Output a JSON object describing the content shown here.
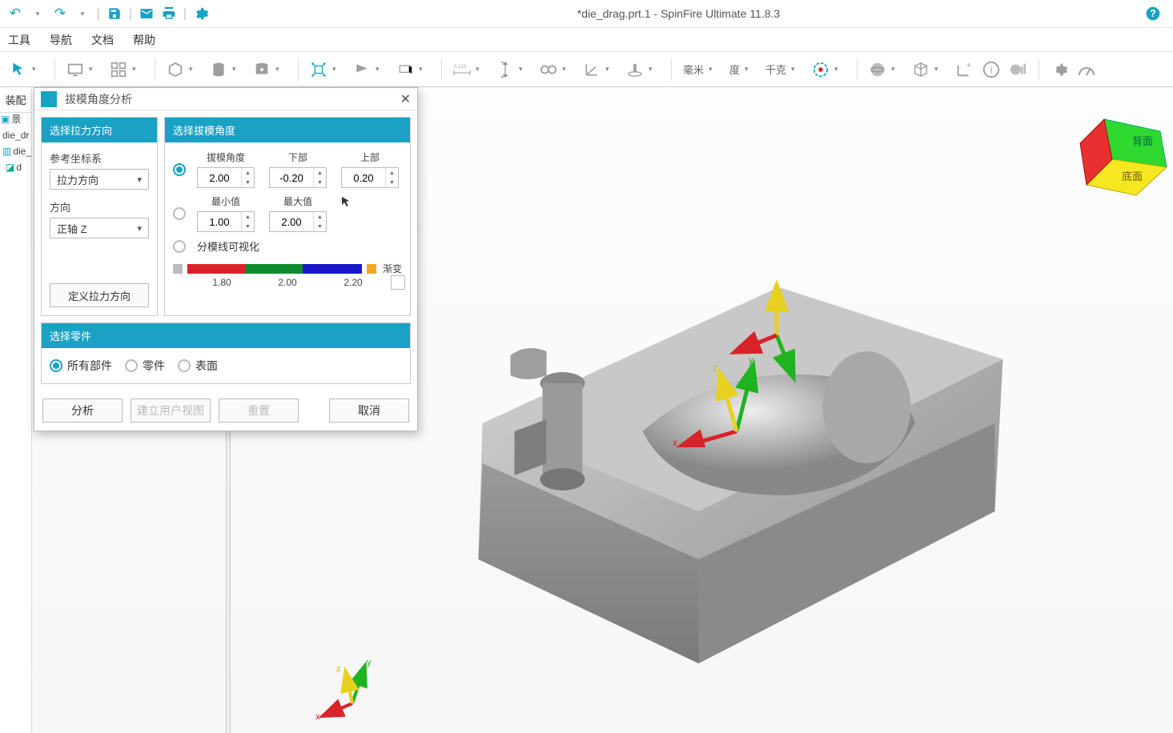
{
  "title": "*die_drag.prt.1 - SpinFire Ultimate 11.8.3",
  "menubar": [
    "工具",
    "导航",
    "文档",
    "帮助"
  ],
  "toolbar": {
    "unit_len": "毫米",
    "unit_ang": "度",
    "unit_mass": "千克"
  },
  "left_tab": "装配",
  "tree": {
    "n1": "景",
    "n2": "die_dr",
    "n3": "die_",
    "n4": "d"
  },
  "dialog": {
    "title": "拔模角度分析",
    "pull": {
      "header": "选择拉力方向",
      "ref_label": "参考坐标系",
      "ref_value": "拉力方向",
      "dir_label": "方向",
      "dir_value": "正轴 Z",
      "btn": "定义拉力方向"
    },
    "angle": {
      "header": "选择拔模角度",
      "c1": "拔模角度",
      "c2": "下部",
      "c3": "上部",
      "v1": "2.00",
      "v2": "-0.20",
      "v3": "0.20",
      "c4": "最小值",
      "c5": "最大值",
      "v4": "1.00",
      "v5": "2.00",
      "vis": "分模线可视化",
      "grad": "渐变",
      "g1": "1.80",
      "g2": "2.00",
      "g3": "2.20"
    },
    "parts": {
      "header": "选择零件",
      "o1": "所有部件",
      "o2": "零件",
      "o3": "表面"
    },
    "foot": {
      "analyze": "分析",
      "userview": "建立用户视图",
      "reset": "重置",
      "cancel": "取消"
    }
  },
  "navcube": {
    "face1": "背面",
    "face2": "底面"
  }
}
